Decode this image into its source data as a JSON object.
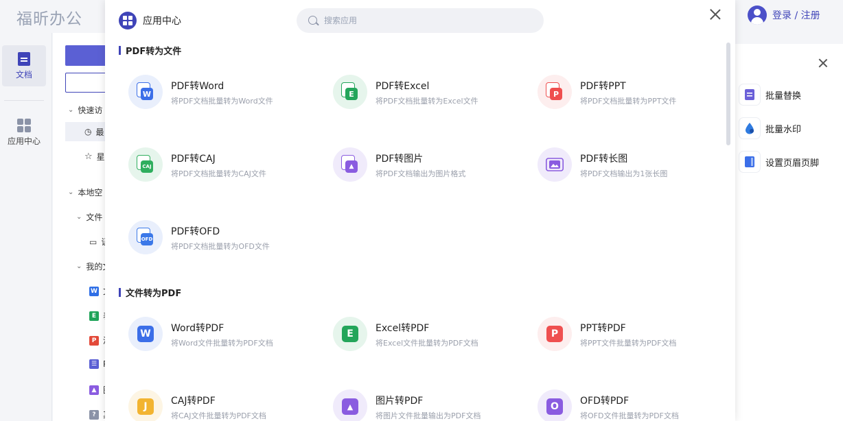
{
  "app": {
    "brand": "福昕办公",
    "login": "登录 / 注册"
  },
  "leftnav": [
    {
      "label": "文档",
      "icon": "document-icon"
    },
    {
      "label": "应用中心",
      "icon": "app-grid-icon"
    }
  ],
  "behind": {
    "tree": [
      "快速访",
      "最",
      "星",
      "本地空",
      "文件",
      "证",
      "我的文",
      "文",
      "表",
      "演",
      "P",
      "图",
      "其"
    ]
  },
  "modal": {
    "title": "应用中心",
    "search_placeholder": "搜索应用",
    "sections": [
      {
        "title": "PDF转为文件",
        "tools": [
          {
            "name": "PDF转Word",
            "desc": "将PDF文档批量转为Word文件",
            "icon": "pdf-to-word-icon",
            "color": "#3b6ee8",
            "bg": "#e9effc",
            "glyph": "W"
          },
          {
            "name": "PDF转Excel",
            "desc": "将PDF文档批量转为Excel文件",
            "icon": "pdf-to-excel-icon",
            "color": "#23a55a",
            "bg": "#e6f5ec",
            "glyph": "E"
          },
          {
            "name": "PDF转PPT",
            "desc": "将PDF文档批量转为PPT文件",
            "icon": "pdf-to-ppt-icon",
            "color": "#ef4f4f",
            "bg": "#fdeeee",
            "glyph": "P"
          },
          {
            "name": "PDF转CAJ",
            "desc": "将PDF文档批量转为CAJ文件",
            "icon": "pdf-to-caj-icon",
            "color": "#2fae5e",
            "bg": "#e6f5ec",
            "glyph": "CAJ"
          },
          {
            "name": "PDF转图片",
            "desc": "将PDF文档输出为图片格式",
            "icon": "pdf-to-image-icon",
            "color": "#8a5ce0",
            "bg": "#f0ebfb",
            "glyph": "▲"
          },
          {
            "name": "PDF转长图",
            "desc": "将PDF文档输出为1张长图",
            "icon": "pdf-to-long-image-icon",
            "color": "#8a5ce0",
            "bg": "#f0ebfb",
            "glyph": "▲"
          },
          {
            "name": "PDF转OFD",
            "desc": "将PDF文档批量转为OFD文件",
            "icon": "pdf-to-ofd-icon",
            "color": "#3b78e8",
            "bg": "#e9effc",
            "glyph": "OFD"
          }
        ]
      },
      {
        "title": "文件转为PDF",
        "tools": [
          {
            "name": "Word转PDF",
            "desc": "将Word文件批量转为PDF文档",
            "icon": "word-to-pdf-icon",
            "color": "#3b6ee8",
            "bg": "#e9effc",
            "glyph": "W"
          },
          {
            "name": "Excel转PDF",
            "desc": "将Excel文件批量转为PDF文档",
            "icon": "excel-to-pdf-icon",
            "color": "#23a55a",
            "bg": "#e6f5ec",
            "glyph": "E"
          },
          {
            "name": "PPT转PDF",
            "desc": "将PPT文件批量转为PDF文档",
            "icon": "ppt-to-pdf-icon",
            "color": "#ef4f4f",
            "bg": "#fdeeee",
            "glyph": "P"
          },
          {
            "name": "CAJ转PDF",
            "desc": "将CAJ文件批量转为PDF文档",
            "icon": "caj-to-pdf-icon",
            "color": "#f2b431",
            "bg": "#fdf5e4",
            "glyph": "J"
          },
          {
            "name": "图片转PDF",
            "desc": "将图片文件批量输出为PDF文档",
            "icon": "image-to-pdf-icon",
            "color": "#8a5ce0",
            "bg": "#f0ebfb",
            "glyph": "▲"
          },
          {
            "name": "OFD转PDF",
            "desc": "将OFD文件批量转为PDF文档",
            "icon": "ofd-to-pdf-icon",
            "color": "#8a5ce0",
            "bg": "#f0ebfb",
            "glyph": "O"
          }
        ]
      }
    ]
  },
  "rightpanel": {
    "items": [
      {
        "label": "批量替换",
        "icon": "batch-replace-icon",
        "color": "#6a5fd8"
      },
      {
        "label": "批量水印",
        "icon": "batch-watermark-icon",
        "color": "#2f7be0"
      },
      {
        "label": "设置页眉页脚",
        "icon": "header-footer-icon",
        "color": "#3b6ee8"
      }
    ]
  }
}
